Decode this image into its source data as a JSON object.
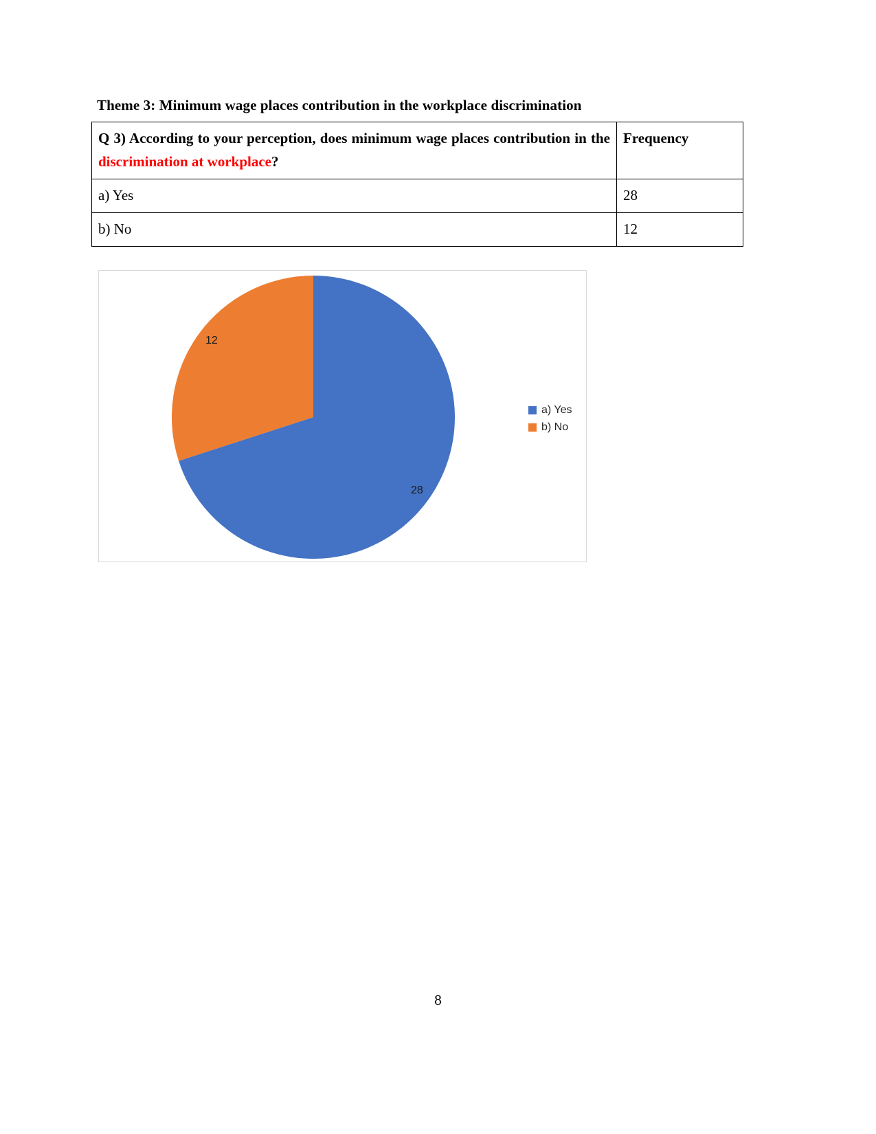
{
  "document": {
    "heading": "Theme 3: Minimum wage places contribution in the workplace discrimination",
    "page_number": "8"
  },
  "table": {
    "question_prefix": "Q 3)  According  to  your  perception,  does  minimum  wage  places contribution in the ",
    "question_highlight": "discrimination at workplace",
    "question_suffix": "?",
    "frequency_header": "Frequency",
    "rows": [
      {
        "option": "a) Yes",
        "frequency": "28"
      },
      {
        "option": "b) No",
        "frequency": "12"
      }
    ]
  },
  "chart_data": {
    "type": "pie",
    "title": "",
    "categories": [
      "a) Yes",
      "b) No"
    ],
    "values": [
      28,
      12
    ],
    "labels": [
      "28",
      "12"
    ],
    "colors": [
      "#4472C4",
      "#ED7D31"
    ],
    "legend_position": "right",
    "start_angle": 0,
    "direction": "clockwise",
    "total": 40,
    "series": [
      {
        "name": "Frequency",
        "values": [
          28,
          12
        ]
      }
    ],
    "slices": [
      {
        "name": "a) Yes",
        "value": 28,
        "label": "28",
        "color": "#4472C4",
        "percent": 70
      },
      {
        "name": "b) No",
        "value": 12,
        "label": "12",
        "color": "#ED7D31",
        "percent": 30
      }
    ],
    "legend": [
      {
        "label": "a) Yes",
        "color": "#4472C4"
      },
      {
        "label": "b) No",
        "color": "#ED7D31"
      }
    ]
  },
  "colors": {
    "series_blue": "#4472C4",
    "series_orange": "#ED7D31",
    "highlight_red": "#FF0000",
    "chart_border": "#D9D9D9",
    "table_border": "#000000"
  }
}
